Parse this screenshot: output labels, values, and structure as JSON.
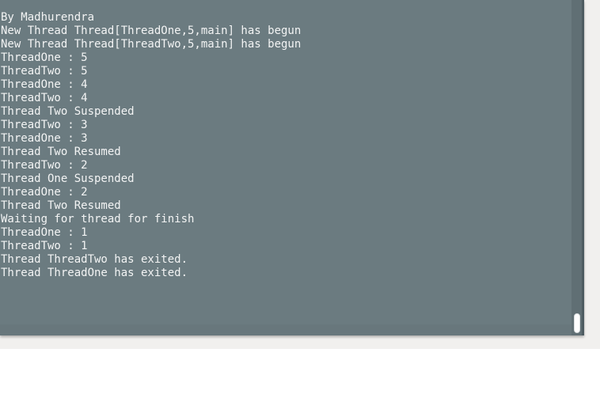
{
  "terminal": {
    "lines": [
      "By Madhurendra",
      "New Thread Thread[ThreadOne,5,main] has begun",
      "New Thread Thread[ThreadTwo,5,main] has begun",
      "ThreadOne : 5",
      "ThreadTwo : 5",
      "ThreadOne : 4",
      "ThreadTwo : 4",
      "Thread Two Suspended",
      "ThreadTwo : 3",
      "ThreadOne : 3",
      "Thread Two Resumed",
      "ThreadTwo : 2",
      "Thread One Suspended",
      "ThreadOne : 2",
      "Thread Two Resumed",
      "Waiting for thread for finish",
      "ThreadOne : 1",
      "ThreadTwo : 1",
      "Thread ThreadTwo has exited.",
      "Thread ThreadOne has exited."
    ]
  },
  "colors": {
    "terminal_background": "#6b7b80",
    "terminal_text": "#f3f4f4",
    "scrollbar_track": "#606f74",
    "scrollbar_thumb": "#ffffff",
    "window_backdrop": "#f1f0ee"
  },
  "scrollbar": {
    "position": "bottom"
  }
}
